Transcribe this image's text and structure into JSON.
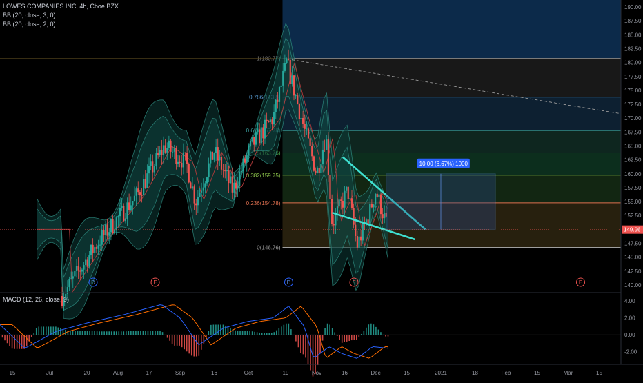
{
  "header": {
    "symbol_line": "LOWES COMPANIES INC, 4h, Cboe BZX",
    "indicator_1": "BB (20, close, 3, 0)",
    "indicator_2": "BB (20, close, 2, 0)",
    "macd_label": "MACD (12, 26, close, 9)"
  },
  "colors": {
    "background": "#000000",
    "up_candle": "#26a69a",
    "down_candle": "#ef5350",
    "bb_fill": "#0d3b36",
    "bb_line": "#2f8f83",
    "bb_basis": "#b43b3b",
    "trendline": "#3fe0d0",
    "macd_line": "#2962ff",
    "signal_line": "#ff6d00",
    "fib_top_zone": "#0c2a4a",
    "fib_bottom_zone": "#3a0d10"
  },
  "chart_data": [
    {
      "type": "candlestick",
      "title": "LOWES COMPANIES INC, 4h, Cboe BZX",
      "price_axis": {
        "ylim": [
          138.75,
          191.25
        ],
        "ticks": [
          "190.00",
          "187.50",
          "185.00",
          "182.50",
          "180.00",
          "177.50",
          "175.00",
          "172.50",
          "170.00",
          "167.50",
          "165.00",
          "162.50",
          "160.00",
          "157.50",
          "155.00",
          "152.50",
          "150.00",
          "147.50",
          "145.00",
          "142.50",
          "140.00"
        ],
        "tick_values": [
          190,
          187.5,
          185,
          182.5,
          180,
          177.5,
          175,
          172.5,
          170,
          167.5,
          165,
          162.5,
          160,
          157.5,
          155,
          152.5,
          150,
          147.5,
          145,
          142.5,
          140
        ],
        "last_price_label": "149.96",
        "last_price": 149.96
      },
      "time_axis": {
        "labels": [
          "15",
          "Jul",
          "20",
          "Aug",
          "17",
          "Sep",
          "16",
          "Oct",
          "19",
          "Nov",
          "16",
          "Dec",
          "15",
          "2021",
          "18",
          "Feb",
          "15",
          "Mar",
          "15"
        ],
        "positions": [
          0.02,
          0.08,
          0.14,
          0.19,
          0.24,
          0.29,
          0.345,
          0.4,
          0.46,
          0.51,
          0.555,
          0.605,
          0.655,
          0.71,
          0.765,
          0.815,
          0.865,
          0.915,
          0.965
        ]
      },
      "fibonacci": [
        {
          "label": "1(180.77)",
          "value": 180.77
        },
        {
          "label": "0.786(173.8)",
          "value": 173.8
        },
        {
          "label": "0.618(167.78)",
          "value": 167.78
        },
        {
          "label": "0.5(163.76)",
          "value": 163.76
        },
        {
          "label": "0.382(159.75)",
          "value": 159.75
        },
        {
          "label": "0.236(154.78)",
          "value": 154.78
        },
        {
          "label": "0(146.76)",
          "value": 146.76
        }
      ],
      "projection_label": "10.00 (6.67%) 1000",
      "projection_box": {
        "low": 150.0,
        "high": 160.0
      },
      "event_markers": [
        {
          "label": "D",
          "pos": 0.15
        },
        {
          "label": "E",
          "pos": 0.25
        },
        {
          "label": "D",
          "pos": 0.465
        },
        {
          "label": "E",
          "pos": 0.57
        },
        {
          "label": "E",
          "pos": 0.935
        }
      ]
    },
    {
      "type": "macd",
      "title": "MACD (12, 26, close, 9)",
      "ylim": [
        -3.5,
        5.0
      ],
      "ticks": [
        "4.00",
        "2.00",
        "0.00",
        "-2.00"
      ],
      "tick_values": [
        4,
        2,
        0,
        -2
      ]
    }
  ]
}
